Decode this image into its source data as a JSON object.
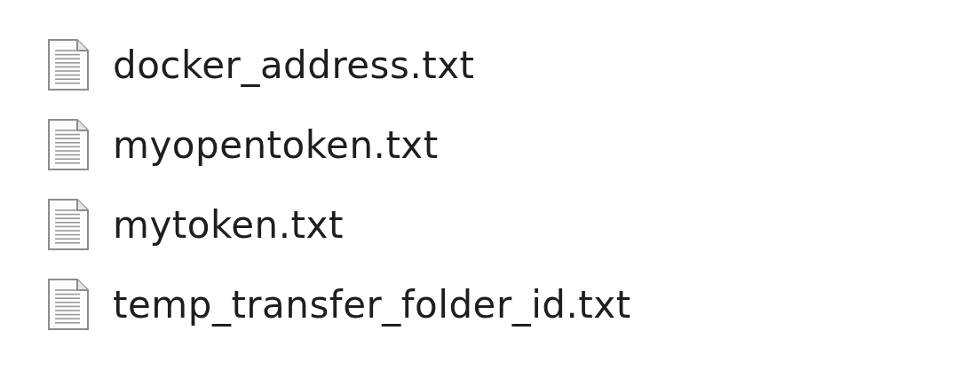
{
  "files": [
    {
      "name": "docker_address.txt"
    },
    {
      "name": "myopentoken.txt"
    },
    {
      "name": "mytoken.txt"
    },
    {
      "name": "temp_transfer_folder_id.txt"
    }
  ]
}
